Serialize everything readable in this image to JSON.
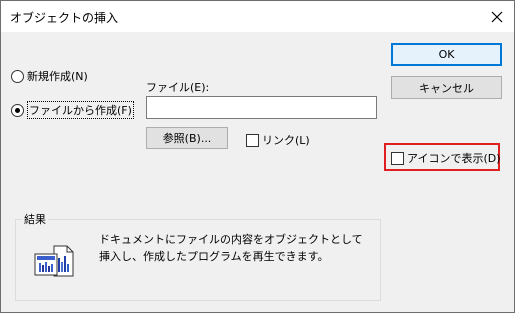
{
  "window": {
    "title": "オブジェクトの挿入"
  },
  "options": {
    "create_new": "新規作成(N)",
    "create_from_file": "ファイルから作成(F)",
    "selected": "create_from_file"
  },
  "file": {
    "label": "ファイル(E):",
    "value": "",
    "browse_label": "参照(B)...",
    "link_label": "リンク(L)",
    "link_checked": false
  },
  "buttons": {
    "ok": "OK",
    "cancel": "キャンセル"
  },
  "display_as_icon": {
    "label": "アイコンで表示(D)",
    "checked": false
  },
  "result": {
    "legend": "結果",
    "description": "ドキュメントにファイルの内容をオブジェクトとして挿入し、作成したプログラムを再生できます。"
  },
  "colors": {
    "accent": "#0078d7",
    "highlight": "#e02020"
  }
}
